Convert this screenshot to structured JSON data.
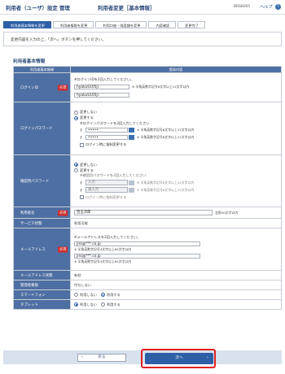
{
  "header": {
    "app_title": "利用者（ユーザ）設定 管理",
    "screen_title": "利用者変更［基本情報］",
    "screen_id": "BRSK005",
    "help_label": "ヘルプ"
  },
  "steps": [
    "利用者基本情報を変更",
    "利用者権限を変更",
    "利用口座・限度額を変更",
    "内容確認",
    "変更完了"
  ],
  "notice": "変更内容を入力の上、「次へ」ボタンを押してください。",
  "section_title": "利用者基本情報",
  "table_header": {
    "col1": "利用者基本情報",
    "col2": "登録内容"
  },
  "required_badge": "必須",
  "login_id": {
    "label": "ログインID",
    "hint": "※ログインIDを2回入力してください。",
    "value1": "hyakuS105ji",
    "value2": "hyakuS105ji",
    "note": "※ 半角英数字記号6文字以上12文字以内"
  },
  "login_password": {
    "label": "ログインパスワード",
    "opt_nochange": "変更しない",
    "opt_change": "変更する",
    "hint": "※ログインパスワードを2回入力してください",
    "value1": "•••••",
    "value2": "•••••",
    "note": "※ 半角英数字記号6文字以上12文字以内",
    "force_change": "ログイン時に強制変更する"
  },
  "confirm_password": {
    "label": "確認用パスワード",
    "opt_nochange": "変更しない",
    "opt_change": "変更する",
    "hint": "※確認用パスワードを2回入力してください",
    "input_label": "入力",
    "reinput_label": "再入力",
    "note": "※ 半角英数字記号6文字以上12文字以内",
    "force_change": "ログイン時に強制変更する"
  },
  "user_name": {
    "label": "利用者名",
    "value": "百五次郎",
    "note": "全角30文字以内"
  },
  "service_status": {
    "label": "サービス状態",
    "value": "利用可能"
  },
  "email": {
    "label": "メールアドレス",
    "hint": "※メールアドレスを2回入力してください。",
    "value1": "jiro@***.co.jp",
    "note1": "※ 半角英数字記号4文字以上64文字以内",
    "value2": "jiro@***.co.jp",
    "note2": "※ 半角英数字記号4文字以上64文字以内"
  },
  "email_status": {
    "label": "メールアドレス状態",
    "value": "有効"
  },
  "admin": {
    "label": "管理者権限",
    "value": "付与しない"
  },
  "smartphone": {
    "label": "スマートフォン",
    "opt_no": "利用しない",
    "opt_yes": "利用する"
  },
  "tablet": {
    "label": "タブレット",
    "opt_no": "利用しない",
    "opt_yes": "利用する"
  },
  "buttons": {
    "back": "戻る",
    "next": "次へ"
  }
}
